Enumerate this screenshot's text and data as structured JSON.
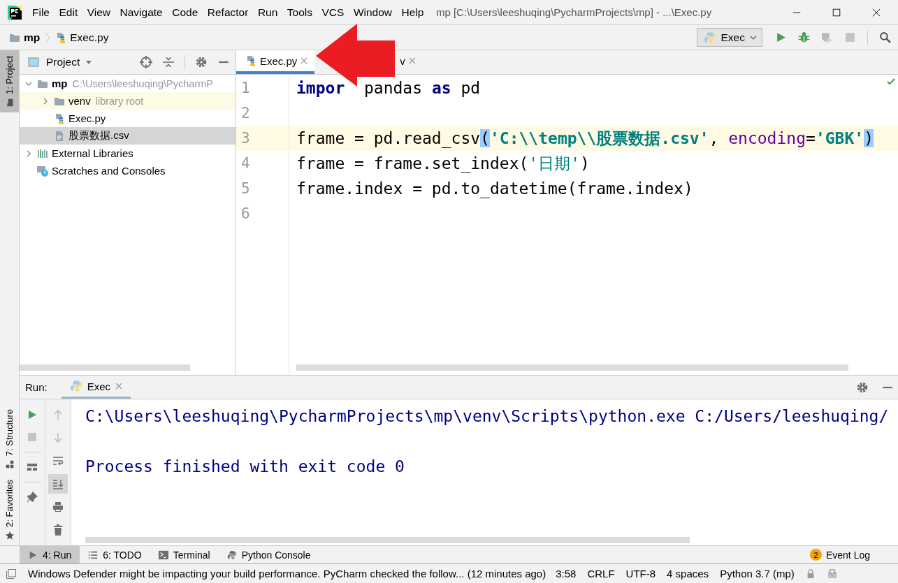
{
  "window": {
    "title": "mp [C:\\Users\\leeshuqing\\PycharmProjects\\mp] - ...\\Exec.py"
  },
  "menu": [
    "File",
    "Edit",
    "View",
    "Navigate",
    "Code",
    "Refactor",
    "Run",
    "Tools",
    "VCS",
    "Window",
    "Help"
  ],
  "breadcrumb": [
    "mp",
    "Exec.py"
  ],
  "run_config": {
    "label": "Exec"
  },
  "nav_actions": [
    {
      "kind": "run",
      "disabled": false
    },
    {
      "kind": "debug",
      "disabled": false
    },
    {
      "kind": "coverage",
      "disabled": true
    },
    {
      "kind": "stop",
      "disabled": true
    },
    {
      "kind": "search",
      "disabled": false
    }
  ],
  "side_tabs_top": [
    {
      "label": "1: Project",
      "selected": true
    }
  ],
  "side_tabs_bottom": [
    {
      "label": "7: Structure",
      "selected": false
    },
    {
      "label": "2: Favorites",
      "selected": false
    }
  ],
  "project_panel": {
    "title": "Project",
    "tree": [
      {
        "kind": "root",
        "name": "mp",
        "hint": "C:\\Users\\leeshuqing\\PycharmP",
        "expanded": true,
        "selected": false,
        "highlighted": false,
        "children": [
          {
            "kind": "folder",
            "name": "venv",
            "hint": "library root",
            "expanded": false,
            "selected": false,
            "highlighted": true
          },
          {
            "kind": "python",
            "name": "Exec.py",
            "selected": false,
            "highlighted": false
          },
          {
            "kind": "text",
            "name": "股票数据.csv",
            "selected": true,
            "highlighted": false
          }
        ]
      },
      {
        "kind": "libraries",
        "name": "External Libraries",
        "expanded": false,
        "selected": false,
        "highlighted": false
      },
      {
        "kind": "scratches",
        "name": "Scratches and Consoles",
        "selected": false,
        "highlighted": false
      }
    ]
  },
  "editor": {
    "tabs": [
      {
        "label": "Exec.py",
        "selected": true
      },
      {
        "label": "v",
        "selected": false
      }
    ],
    "lines": [
      {
        "number": "1",
        "current": false,
        "tokens": [
          {
            "kind": "keyword",
            "text": "impor"
          },
          {
            "kind": "plain",
            "text": "  pandas "
          },
          {
            "kind": "keyword",
            "text": "as"
          },
          {
            "kind": "plain",
            "text": " pd"
          }
        ]
      },
      {
        "number": "2",
        "current": false
      },
      {
        "number": "3",
        "current": true,
        "tokens": [
          {
            "kind": "plain",
            "text": "frame = pd.read_csv"
          },
          {
            "kind": "brace",
            "text": "("
          },
          {
            "kind": "string",
            "text": "'C:\\\\temp\\\\股票数据.csv'"
          },
          {
            "kind": "plain",
            "text": ", "
          },
          {
            "kind": "param",
            "text": "encoding"
          },
          {
            "kind": "plain",
            "text": "="
          },
          {
            "kind": "string",
            "text": "'GBK'"
          },
          {
            "kind": "brace",
            "text": ")"
          }
        ]
      },
      {
        "number": "4",
        "current": false,
        "tokens": [
          {
            "kind": "plain",
            "text": "frame = frame.set_index("
          },
          {
            "kind": "string-plain",
            "text": "'日期'"
          },
          {
            "kind": "plain",
            "text": ")"
          }
        ]
      },
      {
        "number": "5",
        "current": false,
        "tokens": [
          {
            "kind": "plain",
            "text": "frame.index = pd.to_datetime(frame.index)"
          }
        ]
      },
      {
        "number": "6",
        "current": false
      }
    ]
  },
  "run_panel": {
    "title": "Run:",
    "tab": "Exec",
    "tools_main": [
      {
        "kind": "rerun",
        "disabled": false
      },
      {
        "kind": "stop",
        "disabled": true
      },
      {
        "kind": "layout",
        "disabled": false
      },
      {
        "kind": "pin",
        "disabled": false
      }
    ],
    "tools_console": [
      {
        "kind": "up",
        "disabled": true,
        "on": false
      },
      {
        "kind": "down",
        "disabled": true,
        "on": false
      },
      {
        "kind": "wrap",
        "disabled": false,
        "on": false
      },
      {
        "kind": "scroll-end",
        "disabled": false,
        "on": true
      },
      {
        "kind": "print",
        "disabled": false,
        "on": false
      },
      {
        "kind": "trash",
        "disabled": false,
        "on": false
      }
    ],
    "console": [
      "C:\\Users\\leeshuqing\\PycharmProjects\\mp\\venv\\Scripts\\python.exe C:/Users/leeshuqing/",
      "Process finished with exit code 0"
    ]
  },
  "tool_tabs": [
    {
      "kind": "run",
      "label": "4: Run",
      "selected": true
    },
    {
      "kind": "todo",
      "label": "6: TODO",
      "selected": false
    },
    {
      "kind": "terminal",
      "label": "Terminal",
      "selected": false
    },
    {
      "kind": "python",
      "label": "Python Console",
      "selected": false
    }
  ],
  "event_log": {
    "label": "Event Log",
    "count": "2"
  },
  "status_bar": {
    "message": "Windows Defender might be impacting your build performance. PyCharm checked the follow... (12 minutes ago)",
    "items": [
      "3:58",
      "CRLF",
      "UTF-8",
      "4 spaces",
      "Python 3.7 (mp)"
    ]
  }
}
